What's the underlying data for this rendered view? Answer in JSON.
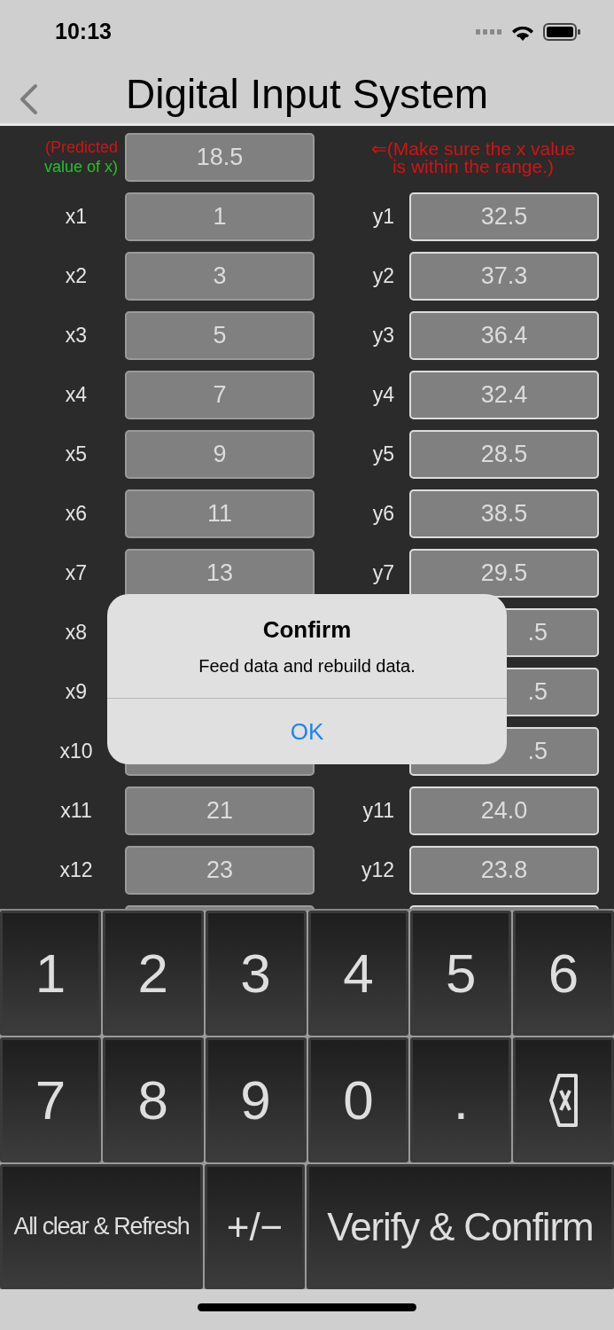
{
  "status_bar": {
    "time": "10:13"
  },
  "nav": {
    "title": "Digital Input System"
  },
  "prediction": {
    "label_1": "(Predicted",
    "label_2": "value of x)",
    "value": "18.5",
    "hint_1": "⇐(Make sure the x value",
    "hint_2": "is within the range.)"
  },
  "rows": [
    {
      "kind": "full",
      "x_label": "x1",
      "x_value": "1",
      "y_label": "y1",
      "y_value": "32.5"
    },
    {
      "kind": "full",
      "x_label": "x2",
      "x_value": "3",
      "y_label": "y2",
      "y_value": "37.3"
    },
    {
      "kind": "full",
      "x_label": "x3",
      "x_value": "5",
      "y_label": "y3",
      "y_value": "36.4"
    },
    {
      "kind": "full",
      "x_label": "x4",
      "x_value": "7",
      "y_label": "y4",
      "y_value": "32.4"
    },
    {
      "kind": "full",
      "x_label": "x5",
      "x_value": "9",
      "y_label": "y5",
      "y_value": "28.5"
    },
    {
      "kind": "full",
      "x_label": "x6",
      "x_value": "11",
      "y_label": "y6",
      "y_value": "38.5"
    },
    {
      "kind": "full",
      "x_label": "x7",
      "x_value": "13",
      "y_label": "y7",
      "y_value": "29.5"
    },
    {
      "kind": "covered",
      "x_label": "x8",
      "y_value": ".5"
    },
    {
      "kind": "covered",
      "x_label": "x9",
      "y_value": ".5"
    },
    {
      "kind": "lower",
      "x_label": "x10",
      "y_value": ".5"
    },
    {
      "kind": "full",
      "x_label": "x11",
      "x_value": "21",
      "y_label": "y11",
      "y_value": "24.0"
    },
    {
      "kind": "full",
      "x_label": "x12",
      "x_value": "23",
      "y_label": "y12",
      "y_value": "23.8"
    },
    {
      "kind": "edge"
    }
  ],
  "keypad": [
    [
      {
        "kind": "char",
        "label": "1"
      },
      {
        "kind": "char",
        "label": "2"
      },
      {
        "kind": "char",
        "label": "3"
      },
      {
        "kind": "char",
        "label": "4"
      },
      {
        "kind": "char",
        "label": "5"
      },
      {
        "kind": "char",
        "label": "6"
      }
    ],
    [
      {
        "kind": "char",
        "label": "7"
      },
      {
        "kind": "char",
        "label": "8"
      },
      {
        "kind": "char",
        "label": "9"
      },
      {
        "kind": "char",
        "label": "0"
      },
      {
        "kind": "char",
        "label": "."
      },
      {
        "kind": "backspace"
      }
    ]
  ],
  "actions": [
    {
      "kind": "wide",
      "label": "All clear & Refresh"
    },
    {
      "kind": "narrow",
      "label": "+/−"
    },
    {
      "kind": "widest",
      "label": "Verify & Confirm"
    }
  ],
  "dialog": {
    "title": "Confirm",
    "message": "Feed data and rebuild data.",
    "button": "OK"
  }
}
